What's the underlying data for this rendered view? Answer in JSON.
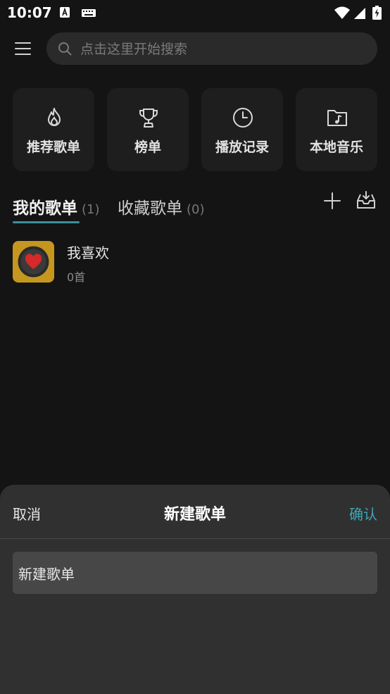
{
  "status_bar": {
    "time": "10:07"
  },
  "search": {
    "placeholder": "点击这里开始搜索"
  },
  "quick_tiles": [
    {
      "label": "推荐歌单",
      "icon": "fire-icon"
    },
    {
      "label": "榜单",
      "icon": "trophy-icon"
    },
    {
      "label": "播放记录",
      "icon": "clock-icon"
    },
    {
      "label": "本地音乐",
      "icon": "music-folder-icon"
    }
  ],
  "tabs": {
    "my_playlists": {
      "label": "我的歌单",
      "count": "(1)"
    },
    "collected": {
      "label": "收藏歌单",
      "count": "(0)"
    }
  },
  "playlists": [
    {
      "title": "我喜欢",
      "subtitle": "0首"
    }
  ],
  "sheet": {
    "cancel": "取消",
    "title": "新建歌单",
    "confirm": "确认",
    "input_value": "新建歌单"
  },
  "colors": {
    "accent": "#3ea6b8",
    "background": "#141414",
    "sheet": "#303030"
  }
}
